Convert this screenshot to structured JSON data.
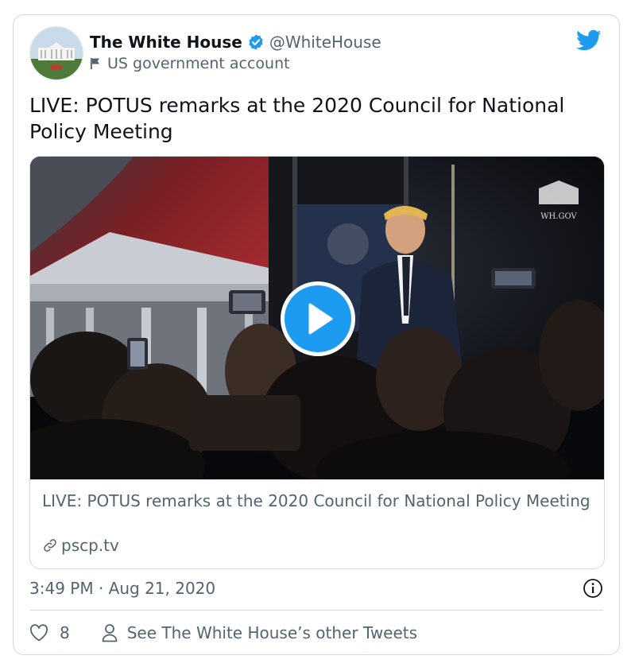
{
  "author": {
    "display_name": "The White House",
    "handle": "@WhiteHouse",
    "label": "US government account"
  },
  "tweet": {
    "text": "LIVE: POTUS remarks at the 2020 Council for National Policy Meeting",
    "timestamp": "3:49 PM · Aug 21, 2020"
  },
  "media": {
    "watermark": "WH.GOV",
    "link_title": "LIVE: POTUS remarks at the 2020 Council for National Policy Meeting",
    "link_domain": "pscp.tv"
  },
  "actions": {
    "like_count": "8",
    "other_tweets_label": "See The White House’s other Tweets"
  },
  "icons": {
    "verified": "verified-badge-icon",
    "label": "flag-icon",
    "brand": "twitter-bird-icon",
    "play": "play-icon",
    "link": "link-icon",
    "info": "info-icon",
    "like": "heart-icon",
    "profile": "person-icon"
  },
  "colors": {
    "accent": "#1d9bf0",
    "text_primary": "#0f1419",
    "text_secondary": "#536471",
    "border": "#cfd9de"
  }
}
